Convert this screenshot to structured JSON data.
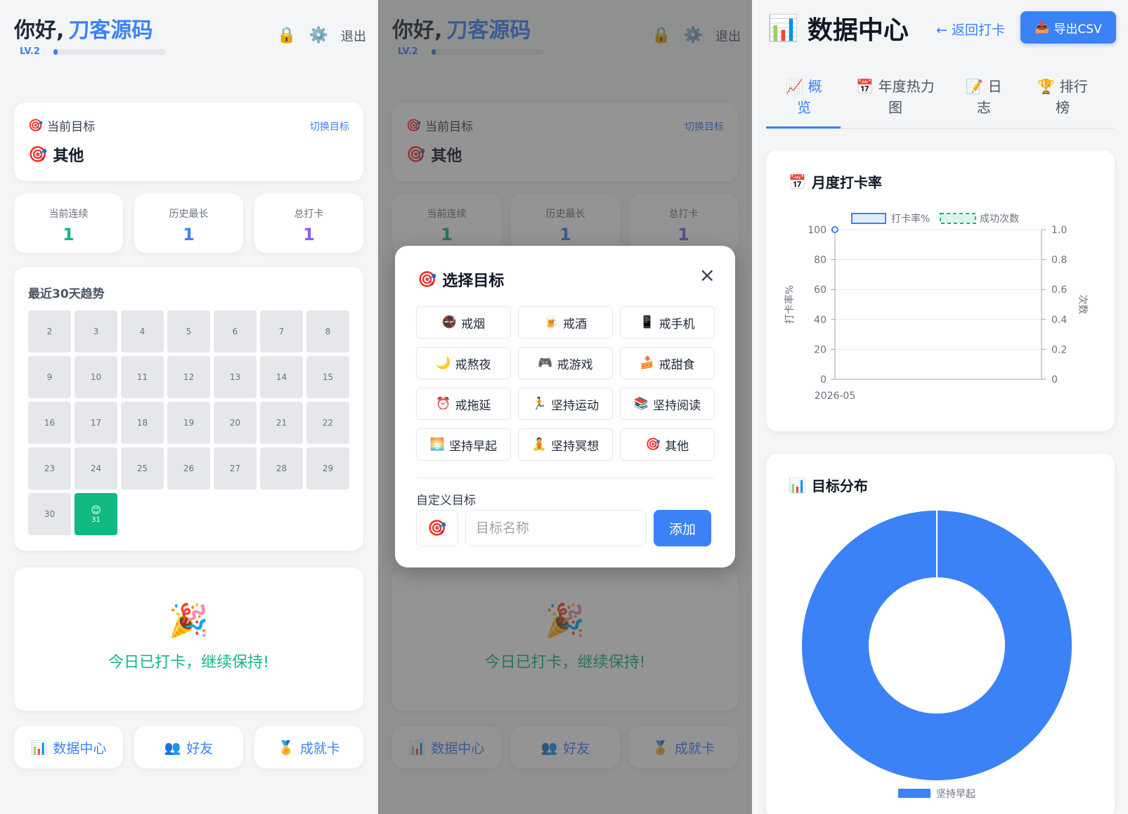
{
  "home": {
    "greeting": "你好,",
    "username": "刀客源码",
    "level": "LV.2",
    "level_progress": 0.04,
    "icons": {
      "lock": "🔒",
      "settings": "⚙️"
    },
    "logout": "退出",
    "goal_card": {
      "header": "当前目标",
      "switch": "切换目标",
      "goal_icon": "🎯",
      "goal_name": "其他"
    },
    "stats": [
      {
        "label": "当前连续",
        "value": "1",
        "color": "#10b981"
      },
      {
        "label": "历史最长",
        "value": "1",
        "color": "#3b82f6"
      },
      {
        "label": "总打卡",
        "value": "1",
        "color": "#8b5cf6"
      }
    ],
    "trend": {
      "title": "最近30天趋势",
      "days": [
        "2",
        "3",
        "4",
        "5",
        "6",
        "7",
        "8",
        "9",
        "10",
        "11",
        "12",
        "13",
        "14",
        "15",
        "16",
        "17",
        "18",
        "19",
        "20",
        "21",
        "22",
        "23",
        "24",
        "25",
        "26",
        "27",
        "28",
        "29",
        "30",
        "31"
      ],
      "checked_day": "31",
      "checked_emoji": "😊"
    },
    "done": {
      "emoji": "🎉",
      "message": "今日已打卡，继续保持!"
    },
    "nav": [
      {
        "icon": "📊",
        "label": "数据中心"
      },
      {
        "icon": "👥",
        "label": "好友"
      },
      {
        "icon": "🏅",
        "label": "成就卡"
      }
    ]
  },
  "modal": {
    "title_icon": "🎯",
    "title": "选择目标",
    "close": "×",
    "options": [
      {
        "icon": "🚭",
        "label": "戒烟"
      },
      {
        "icon": "🍺",
        "label": "戒酒"
      },
      {
        "icon": "📱",
        "label": "戒手机"
      },
      {
        "icon": "🌙",
        "label": "戒熬夜"
      },
      {
        "icon": "🎮",
        "label": "戒游戏"
      },
      {
        "icon": "🍰",
        "label": "戒甜食"
      },
      {
        "icon": "⏰",
        "label": "戒拖延"
      },
      {
        "icon": "🏃",
        "label": "坚持运动"
      },
      {
        "icon": "📚",
        "label": "坚持阅读"
      },
      {
        "icon": "🌅",
        "label": "坚持早起"
      },
      {
        "icon": "🧘",
        "label": "坚持冥想"
      },
      {
        "icon": "🎯",
        "label": "其他"
      }
    ],
    "custom_label": "自定义目标",
    "custom_emoji": "🎯",
    "input_placeholder": "目标名称",
    "add_button": "添加"
  },
  "datacenter": {
    "title_icon": "📊",
    "title": "数据中心",
    "back": "← 返回打卡",
    "export_icon": "📤",
    "export": "导出CSV",
    "tabs": [
      {
        "icon": "📈",
        "line1": "概",
        "line2": "览"
      },
      {
        "icon": "📅",
        "line1": "年度热力",
        "line2": "图"
      },
      {
        "icon": "📝",
        "line1": "日",
        "line2": "志"
      },
      {
        "icon": "🏆",
        "line1": "排行",
        "line2": "榜"
      }
    ],
    "active_tab": 0,
    "monthly_title_icon": "📅",
    "monthly_title": "月度打卡率",
    "dist_title_icon": "📊",
    "dist_title": "目标分布"
  },
  "chart_data": [
    {
      "type": "line",
      "title": "月度打卡率",
      "x": [
        "2026-05"
      ],
      "series": [
        {
          "name": "打卡率%",
          "values": [
            100
          ],
          "axis": "left",
          "color": "#3b82f6"
        },
        {
          "name": "成功次数",
          "values": [
            0
          ],
          "axis": "right",
          "color": "#10b981",
          "dashed": true
        }
      ],
      "ylabel": "打卡率%",
      "y2label": "次数",
      "ylim": [
        0,
        100
      ],
      "y2lim": [
        0,
        1.0
      ],
      "yticks": [
        "0",
        "20",
        "40",
        "60",
        "80",
        "100"
      ],
      "y2ticks": [
        "0",
        "0.2",
        "0.4",
        "0.6",
        "0.8",
        "1.0"
      ],
      "legend": "top",
      "grid": true
    },
    {
      "type": "pie",
      "title": "目标分布",
      "categories": [
        "坚持早起"
      ],
      "values": [
        1
      ],
      "colors": [
        "#3b82f6"
      ],
      "donut": true,
      "legend": "bottom"
    }
  ]
}
